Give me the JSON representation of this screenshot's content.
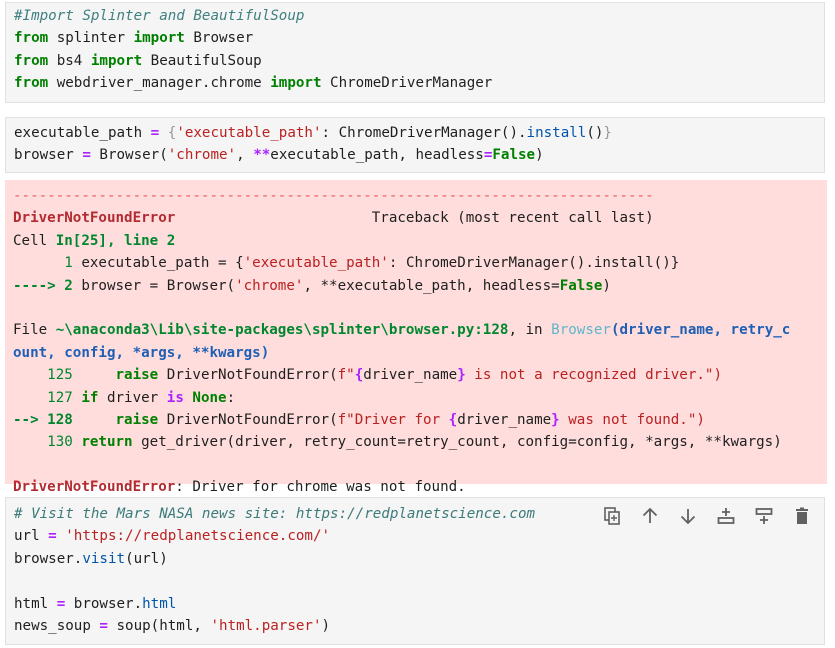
{
  "cells": [
    {
      "lines": [
        [
          {
            "t": "#Import Splinter and BeautifulSoup",
            "c": "cm"
          }
        ],
        [
          {
            "t": "from",
            "c": "kw"
          },
          {
            "t": " splinter "
          },
          {
            "t": "import",
            "c": "kw"
          },
          {
            "t": " Browser"
          }
        ],
        [
          {
            "t": "from",
            "c": "kw"
          },
          {
            "t": " bs4 "
          },
          {
            "t": "import",
            "c": "kw"
          },
          {
            "t": " BeautifulSoup"
          }
        ],
        [
          {
            "t": "from",
            "c": "kw"
          },
          {
            "t": " webdriver_manager.chrome "
          },
          {
            "t": "import",
            "c": "kw"
          },
          {
            "t": " ChromeDriverManager"
          }
        ]
      ]
    },
    {
      "lines": [
        [
          {
            "t": "executable_path "
          },
          {
            "t": "=",
            "c": "op"
          },
          {
            "t": " "
          },
          {
            "t": "{",
            "c": "brace"
          },
          {
            "t": "'executable_path'",
            "c": "str"
          },
          {
            "t": ": ChromeDriverManager()."
          },
          {
            "t": "install",
            "c": "attr"
          },
          {
            "t": "()"
          },
          {
            "t": "}",
            "c": "brace"
          }
        ],
        [
          {
            "t": "browser "
          },
          {
            "t": "=",
            "c": "op"
          },
          {
            "t": " Browser("
          },
          {
            "t": "'chrome'",
            "c": "str"
          },
          {
            "t": ", "
          },
          {
            "t": "**",
            "c": "op"
          },
          {
            "t": "executable_path, headless"
          },
          {
            "t": "=",
            "c": "op"
          },
          {
            "t": "False",
            "c": "kw"
          },
          {
            "t": ")"
          }
        ]
      ]
    },
    {
      "lines": [
        [
          {
            "t": "# Visit the Mars NASA news site: https://redplanetscience.com",
            "c": "cm2"
          }
        ],
        [
          {
            "t": "url "
          },
          {
            "t": "=",
            "c": "op"
          },
          {
            "t": " "
          },
          {
            "t": "'https://redplanetscience.com/'",
            "c": "str"
          }
        ],
        [
          {
            "t": "browser."
          },
          {
            "t": "visit",
            "c": "attr"
          },
          {
            "t": "(url)"
          }
        ],
        [
          {
            "t": ""
          }
        ],
        [
          {
            "t": "html "
          },
          {
            "t": "=",
            "c": "op"
          },
          {
            "t": " browser."
          },
          {
            "t": "html",
            "c": "attr"
          }
        ],
        [
          {
            "t": "news_soup "
          },
          {
            "t": "=",
            "c": "op"
          },
          {
            "t": " soup(html, "
          },
          {
            "t": "'html.parser'",
            "c": "str"
          },
          {
            "t": ")"
          }
        ]
      ]
    }
  ],
  "error_output": {
    "lines": [
      [
        {
          "t": "---------------------------------------------------------------------------",
          "c": "dash"
        }
      ],
      [
        {
          "t": "DriverNotFoundError",
          "c": "err"
        },
        {
          "t": "                       Traceback (most recent call last)"
        }
      ],
      [
        {
          "t": "Cell "
        },
        {
          "t": "In[25], line 2",
          "c": "gb"
        }
      ],
      [
        {
          "t": "      "
        },
        {
          "t": "1",
          "c": "g"
        },
        {
          "t": " executable_path = {"
        },
        {
          "t": "'executable_path'",
          "c": "str"
        },
        {
          "t": ": ChromeDriverManager().install()}"
        }
      ],
      [
        {
          "t": "----> 2",
          "c": "gb"
        },
        {
          "t": " browser = Browser("
        },
        {
          "t": "'chrome'",
          "c": "str"
        },
        {
          "t": ", **executable_path, headless="
        },
        {
          "t": "False",
          "c": "kw"
        },
        {
          "t": ")"
        }
      ],
      [
        {
          "t": ""
        }
      ],
      [
        {
          "t": "File "
        },
        {
          "t": "~\\anaconda3\\Lib\\site-packages\\splinter\\browser.py:128",
          "c": "gb"
        },
        {
          "t": ", in "
        },
        {
          "t": "Browser",
          "c": "cyan"
        },
        {
          "t": "(driver_name, retry_c",
          "c": "blueb"
        }
      ],
      [
        {
          "t": "ount, config, *args, **kwargs)",
          "c": "blueb"
        }
      ],
      [
        {
          "t": "    "
        },
        {
          "t": "125",
          "c": "g"
        },
        {
          "t": "     "
        },
        {
          "t": "raise",
          "c": "kw"
        },
        {
          "t": " DriverNotFoundError("
        },
        {
          "t": "f\"",
          "c": "str"
        },
        {
          "t": "{",
          "c": "op"
        },
        {
          "t": "driver_name"
        },
        {
          "t": "}",
          "c": "op"
        },
        {
          "t": " is not a recognized driver.\")",
          "c": "str"
        }
      ],
      [
        {
          "t": "    "
        },
        {
          "t": "127",
          "c": "g"
        },
        {
          "t": " "
        },
        {
          "t": "if",
          "c": "kw"
        },
        {
          "t": " driver "
        },
        {
          "t": "is",
          "c": "op"
        },
        {
          "t": " "
        },
        {
          "t": "None",
          "c": "kw"
        },
        {
          "t": ":"
        }
      ],
      [
        {
          "t": "--> 128",
          "c": "gb"
        },
        {
          "t": "     "
        },
        {
          "t": "raise",
          "c": "kw"
        },
        {
          "t": " DriverNotFoundError("
        },
        {
          "t": "f\"Driver for ",
          "c": "str"
        },
        {
          "t": "{",
          "c": "op"
        },
        {
          "t": "driver_name"
        },
        {
          "t": "}",
          "c": "op"
        },
        {
          "t": " was not found.\")",
          "c": "str"
        }
      ],
      [
        {
          "t": "    "
        },
        {
          "t": "130",
          "c": "g"
        },
        {
          "t": " "
        },
        {
          "t": "return",
          "c": "kw"
        },
        {
          "t": " get_driver(driver, retry_count=retry_count, config=config, *args, **kwargs)"
        }
      ],
      [
        {
          "t": ""
        }
      ],
      [
        {
          "t": "DriverNotFoundError",
          "c": "err"
        },
        {
          "t": ": Driver for chrome was not found."
        }
      ]
    ]
  },
  "cell_toolbar": [
    {
      "name": "duplicate-cell-button",
      "icon": "duplicate-icon"
    },
    {
      "name": "move-up-button",
      "icon": "arrow-up-icon"
    },
    {
      "name": "move-down-button",
      "icon": "arrow-down-icon"
    },
    {
      "name": "insert-above-button",
      "icon": "insert-above-icon"
    },
    {
      "name": "insert-below-button",
      "icon": "insert-below-icon"
    },
    {
      "name": "delete-cell-button",
      "icon": "trash-icon"
    }
  ]
}
